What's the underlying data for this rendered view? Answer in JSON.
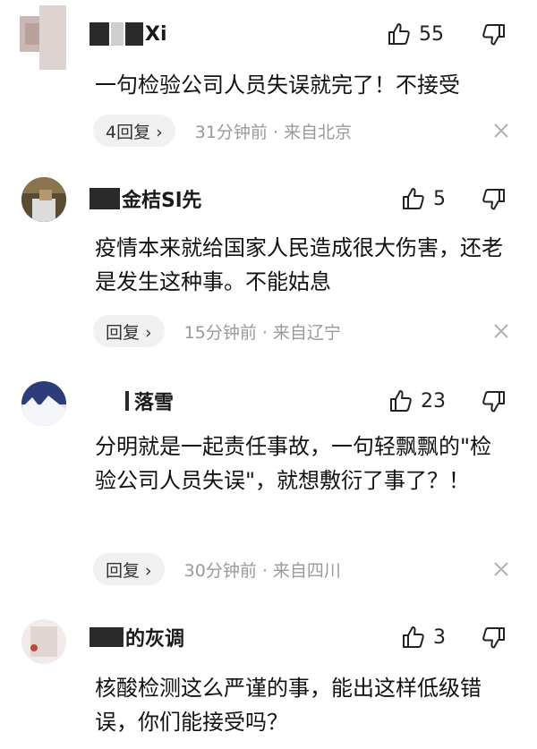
{
  "comments": [
    {
      "name": "Xi",
      "likes": "55",
      "text": "一句检验公司人员失误就完了！不接受",
      "reply_label": "4回复 ›",
      "time": "31分钟前 · 来自北京"
    },
    {
      "name": "金桔Sl先",
      "likes": "5",
      "text": "疫情本来就给国家人民造成很大伤害，还老是发生这种事。不能姑息",
      "reply_label": "回复 ›",
      "time": "15分钟前 · 来自辽宁"
    },
    {
      "name": "落雪",
      "likes": "23",
      "text": "分明就是一起责任事故，一句轻飘飘的\"检验公司人员失误\"，就想敷衍了事了？！",
      "reply_label": "回复 ›",
      "time": "30分钟前 · 来自四川"
    },
    {
      "name": "的灰调",
      "likes": "3",
      "text": "核酸检测这么严谨的事，能出这样低级错误，你们能接受吗？",
      "reply_label": "",
      "time": ""
    }
  ],
  "colors": {
    "text": "#121212",
    "meta": "#9a9a9a",
    "reply_bg": "#f1f1f1"
  }
}
